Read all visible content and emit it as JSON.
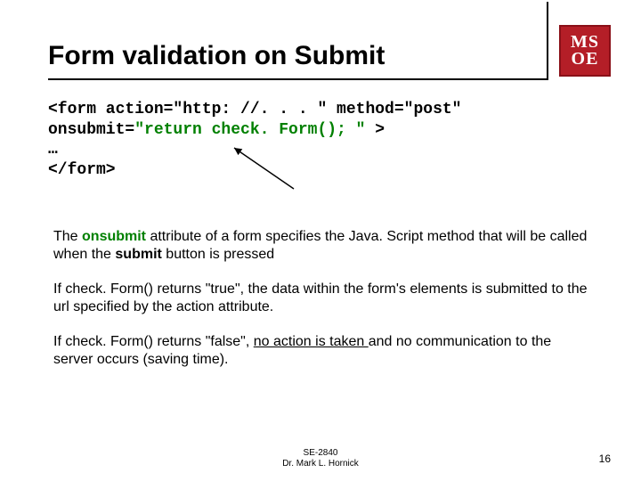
{
  "title": "Form validation on Submit",
  "logo": {
    "line1": "MS",
    "line2": "OE"
  },
  "code": {
    "l1a": "<form action=\"http: //. . . \" method=\"post\"",
    "l2a": "onsubmit=",
    "l2b": "\"return check. Form(); \"",
    "l2c": " >",
    "l3": "…",
    "l4": "</form>"
  },
  "body": {
    "p1a": "The ",
    "p1b": "onsubmit",
    "p1c": " attribute of a form specifies the Java. Script method that will be called when the ",
    "p1d": "submit",
    "p1e": " button is pressed",
    "p2": "If check. Form() returns \"true\", the data within the form's elements is submitted to the url specified by the action attribute.",
    "p3a": "If check. Form() returns \"false\", ",
    "p3b": "no action is taken ",
    "p3c": "and no communication to the server occurs (saving time)."
  },
  "footer": {
    "course": "SE-2840",
    "author": "Dr. Mark L. Hornick"
  },
  "page": "16"
}
